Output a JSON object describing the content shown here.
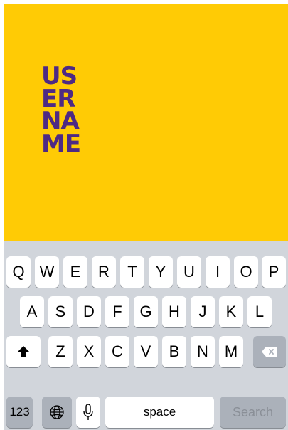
{
  "colors": {
    "background": "#ffcb05",
    "title": "#4e2a84",
    "keyboard": "#d1d5db"
  },
  "title_lines": [
    "US",
    "ER",
    "NA",
    "ME"
  ],
  "keyboard": {
    "row1": [
      "Q",
      "W",
      "E",
      "R",
      "T",
      "Y",
      "U",
      "I",
      "O",
      "P"
    ],
    "row2": [
      "A",
      "S",
      "D",
      "F",
      "G",
      "H",
      "J",
      "K",
      "L"
    ],
    "row3": [
      "Z",
      "X",
      "C",
      "V",
      "B",
      "N",
      "M"
    ],
    "numbers_label": "123",
    "space_label": "space",
    "return_label": "Search",
    "icons": {
      "shift": "shift-icon",
      "delete": "backspace-icon",
      "globe": "globe-icon",
      "mic": "microphone-icon"
    }
  }
}
